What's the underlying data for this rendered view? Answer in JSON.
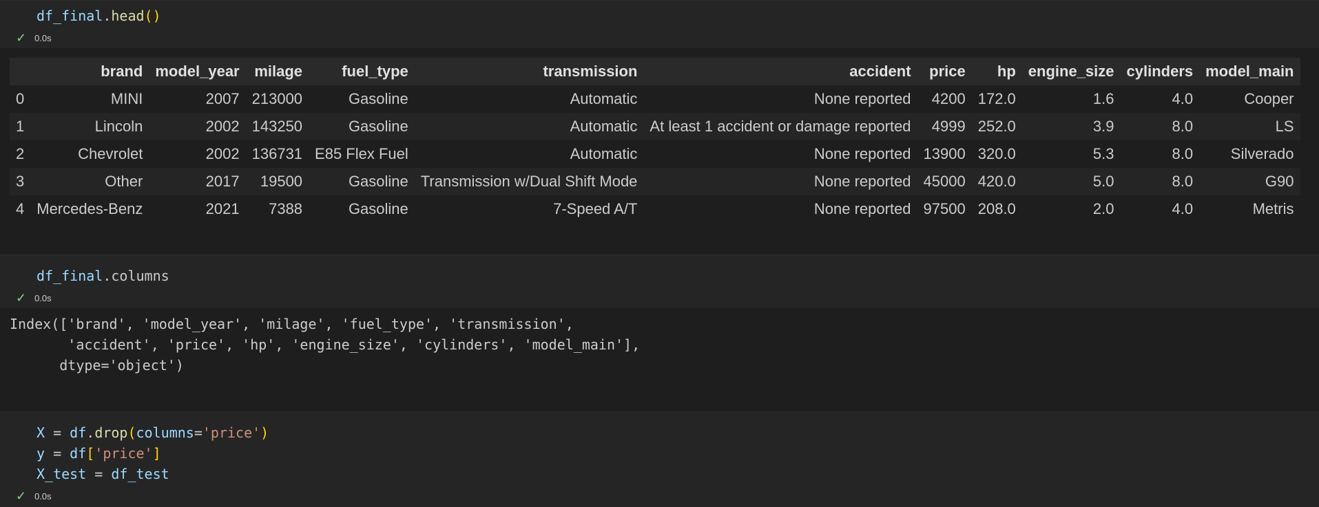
{
  "cells": [
    {
      "code": {
        "var": "df_final",
        "dot": ".",
        "method": "head",
        "paren_open": "(",
        "paren_close": ")"
      },
      "status": {
        "check": "✓",
        "time": "0.0s"
      },
      "output": {
        "columns": [
          "",
          "brand",
          "model_year",
          "milage",
          "fuel_type",
          "transmission",
          "accident",
          "price",
          "hp",
          "engine_size",
          "cylinders",
          "model_main"
        ],
        "rows": [
          [
            "0",
            "MINI",
            "2007",
            "213000",
            "Gasoline",
            "Automatic",
            "None reported",
            "4200",
            "172.0",
            "1.6",
            "4.0",
            "Cooper"
          ],
          [
            "1",
            "Lincoln",
            "2002",
            "143250",
            "Gasoline",
            "Automatic",
            "At least 1 accident or damage reported",
            "4999",
            "252.0",
            "3.9",
            "8.0",
            "LS"
          ],
          [
            "2",
            "Chevrolet",
            "2002",
            "136731",
            "E85 Flex Fuel",
            "Automatic",
            "None reported",
            "13900",
            "320.0",
            "5.3",
            "8.0",
            "Silverado"
          ],
          [
            "3",
            "Other",
            "2017",
            "19500",
            "Gasoline",
            "Transmission w/Dual Shift Mode",
            "None reported",
            "45000",
            "420.0",
            "5.0",
            "8.0",
            "G90"
          ],
          [
            "4",
            "Mercedes-Benz",
            "2021",
            "7388",
            "Gasoline",
            "7-Speed A/T",
            "None reported",
            "97500",
            "208.0",
            "2.0",
            "4.0",
            "Metris"
          ]
        ]
      }
    },
    {
      "code": {
        "var": "df_final",
        "dot": ".",
        "attr": "columns"
      },
      "status": {
        "check": "✓",
        "time": "0.0s"
      },
      "output": {
        "lines": [
          "Index(['brand', 'model_year', 'milage', 'fuel_type', 'transmission',",
          "       'accident', 'price', 'hp', 'engine_size', 'cylinders', 'model_main'],",
          "      dtype='object')"
        ]
      }
    },
    {
      "code": {
        "line1": {
          "lhs": "X",
          "eq": " = ",
          "obj": "df",
          "dot": ".",
          "fn": "drop",
          "po": "(",
          "param": "columns",
          "peq": "=",
          "str": "'price'",
          "pc": ")"
        },
        "line2": {
          "lhs": "y",
          "eq": " = ",
          "obj": "df",
          "bo": "[",
          "str": "'price'",
          "bc": "]"
        },
        "line3": {
          "lhs": "X_test",
          "eq": " = ",
          "rhs": "df_test"
        }
      },
      "status": {
        "check": "✓",
        "time": "0.0s"
      }
    }
  ]
}
